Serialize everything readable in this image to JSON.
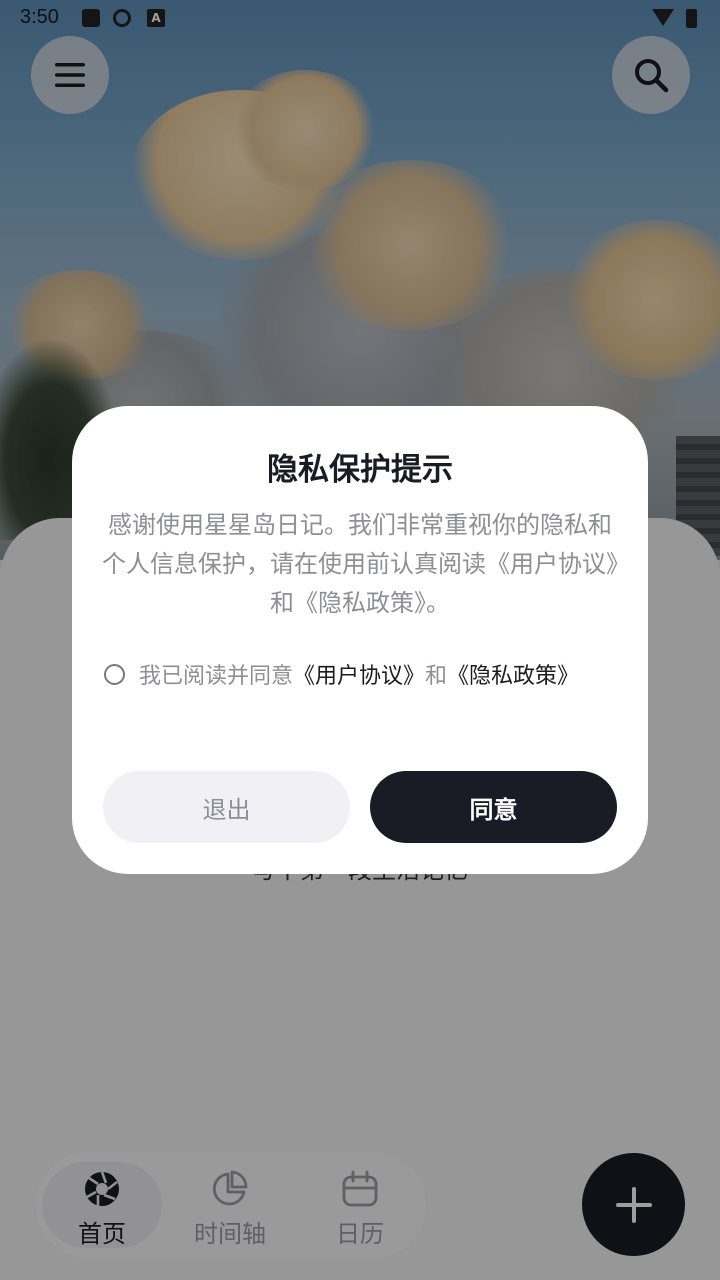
{
  "status_bar": {
    "time": "3:50"
  },
  "home": {
    "hint_text": "写下第一段生活记忆"
  },
  "bottom_nav": {
    "items": [
      {
        "label": "首页",
        "icon": "aperture-icon",
        "active": true
      },
      {
        "label": "时间轴",
        "icon": "pie-chart-icon",
        "active": false
      },
      {
        "label": "日历",
        "icon": "calendar-icon",
        "active": false
      }
    ]
  },
  "dialog": {
    "title": "隐私保护提示",
    "body": "感谢使用星星岛日记。我们非常重视你的隐私和个人信息保护，请在使用前认真阅读《用户协议》和《隐私政策》。",
    "consent_prefix": "我已阅读并同意",
    "user_agreement": "《用户协议》",
    "consent_and": "和",
    "privacy_policy": "《隐私政策》",
    "exit_label": "退出",
    "agree_label": "同意"
  },
  "colors": {
    "dark": "#1b1b26",
    "muted_text": "#8e8e96",
    "exit_bg": "#f1f1f5"
  }
}
